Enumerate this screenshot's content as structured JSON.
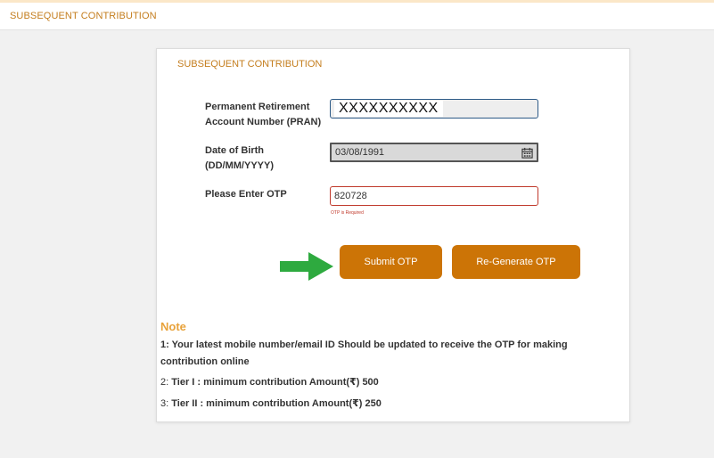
{
  "header": {
    "title": "SUBSEQUENT CONTRIBUTION"
  },
  "form": {
    "title": "SUBSEQUENT CONTRIBUTION",
    "pran": {
      "label_line1": "Permanent Retirement",
      "label_line2": "Account Number (PRAN)",
      "value": "XXXXXXXXXX"
    },
    "dob": {
      "label_line1": "Date of Birth",
      "label_line2": "(DD/MM/YYYY)",
      "value": "03/08/1991",
      "icon": "calendar-icon"
    },
    "otp": {
      "label": "Please Enter OTP",
      "value": "820728",
      "error": "OTP is Required"
    },
    "submit_label": "Submit OTP",
    "regenerate_label": "Re-Generate OTP"
  },
  "note": {
    "title": "Note",
    "items": [
      {
        "num": "1:",
        "text": " Your latest mobile number/email ID Should be updated to receive the OTP for making contribution online"
      },
      {
        "num": "2:",
        "text": " Tier I : minimum contribution Amount(₹) 500"
      },
      {
        "num": "3:",
        "text": " Tier II : minimum contribution Amount(₹) 250"
      }
    ]
  },
  "colors": {
    "accent": "#cc7406",
    "title": "#c47d1d",
    "note_title": "#e8a23a",
    "error": "#c0392b",
    "arrow": "#2eaa3f"
  }
}
